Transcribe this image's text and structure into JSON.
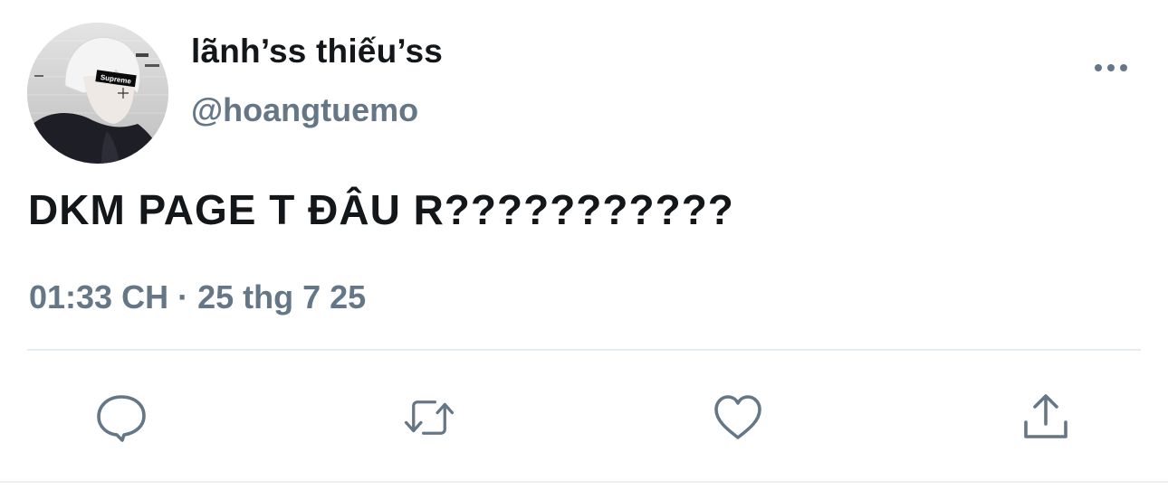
{
  "tweet": {
    "display_name": "lãnh’ss thiếu’ss",
    "handle": "@hoangtuemo",
    "text": "DKM PAGE T ĐÂU R???????????",
    "time": "01:33 CH",
    "separator": "·",
    "date": "25 thg 7 25",
    "avatar": {
      "badge_text": "Supreme",
      "badge_color": "#000000"
    }
  },
  "actions": [
    {
      "name": "reply",
      "icon": "comment-icon"
    },
    {
      "name": "retweet",
      "icon": "retweet-icon"
    },
    {
      "name": "like",
      "icon": "heart-icon"
    },
    {
      "name": "share",
      "icon": "share-icon"
    }
  ],
  "colors": {
    "text_primary": "#14171a",
    "text_secondary": "#657786",
    "divider": "#e6ecf0"
  }
}
